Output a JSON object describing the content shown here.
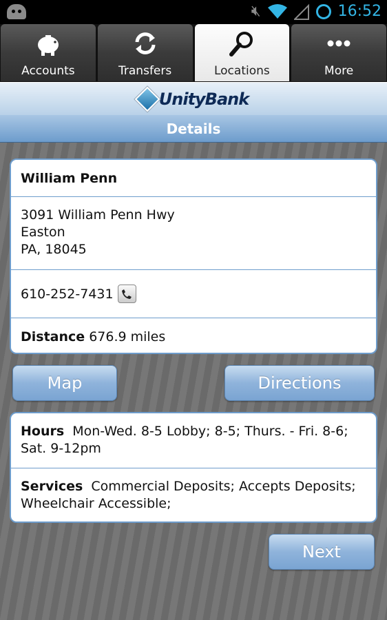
{
  "status_bar": {
    "time": "16:52"
  },
  "tabs": [
    {
      "label": "Accounts",
      "icon": "piggy-bank-icon",
      "active": false
    },
    {
      "label": "Transfers",
      "icon": "refresh-arrows-icon",
      "active": false
    },
    {
      "label": "Locations",
      "icon": "magnifier-icon",
      "active": true
    },
    {
      "label": "More",
      "icon": "more-dots-icon",
      "active": false
    }
  ],
  "header": {
    "brand": "UnityBank",
    "title": "Details"
  },
  "location": {
    "name": "William Penn",
    "address_line1": "3091 William Penn Hwy",
    "address_line2": "Easton",
    "address_line3": "PA, 18045",
    "phone": "610-252-7431",
    "distance_label": "Distance",
    "distance_value": "676.9 miles"
  },
  "buttons": {
    "map": "Map",
    "directions": "Directions",
    "next": "Next"
  },
  "info": {
    "hours_label": "Hours",
    "hours_value": "Mon-Wed. 8-5 Lobby; 8-5; Thurs. - Fri. 8-6; Sat. 9-12pm",
    "services_label": "Services",
    "services_value": "Commercial Deposits; Accepts Deposits; Wheelchair Accessible;"
  },
  "colors": {
    "accent": "#6d9ccc",
    "status": "#33b5e5",
    "brand_text": "#0e2a56"
  }
}
